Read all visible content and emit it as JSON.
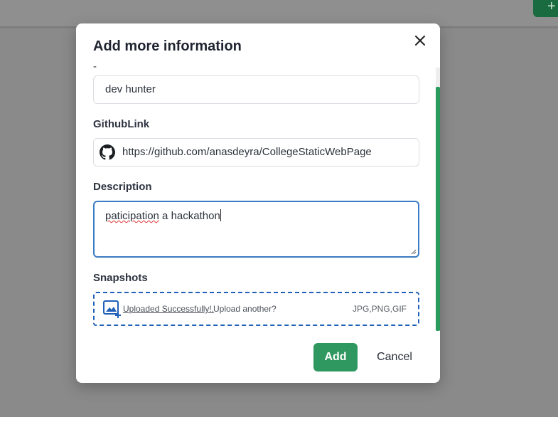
{
  "background": {
    "top_button_label": "+"
  },
  "modal": {
    "title": "Add more information",
    "fields": {
      "cut_label": "-",
      "name_value": "dev hunter",
      "github_label": "GithubLink",
      "github_value": "https://github.com/anasdeyra/CollegeStaticWebPage",
      "description_label": "Description",
      "description_value_misspelled": "paticipation",
      "description_value_rest": " a hackathon",
      "snapshots_label": "Snapshots",
      "upload_success": "Uploaded Successfully!.",
      "upload_another": "Upload another?",
      "file_types": "JPG,PNG,GIF"
    },
    "actions": {
      "add_label": "Add",
      "cancel_label": "Cancel"
    }
  },
  "colors": {
    "primary": "#2f9760",
    "focus": "#3b7cc4",
    "dropzone": "#1f60b8",
    "scroll_thumb": "#2a9b5c"
  },
  "icons": [
    "close-icon",
    "github-icon",
    "image-upload-icon"
  ]
}
